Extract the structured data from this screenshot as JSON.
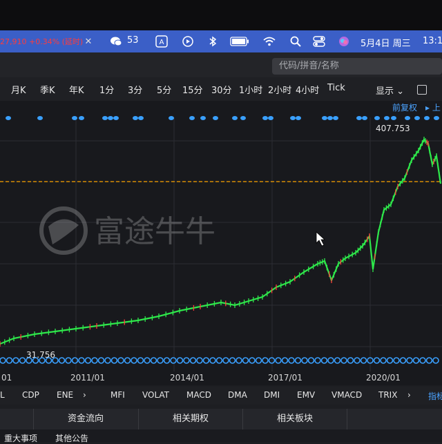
{
  "menubar": {
    "ticker_text": "27,910 +0.34% (延时)",
    "wechat_count": "53",
    "date_time": "5月4日 周三",
    "clock": "13:1",
    "battery_icon": "battery-icon"
  },
  "search": {
    "placeholder": "代码/拼音/名称"
  },
  "periods": [
    "月K",
    "季K",
    "年K",
    "1分",
    "3分",
    "5分",
    "15分",
    "30分",
    "1小时",
    "2小时",
    "4小时",
    "Tick"
  ],
  "display": {
    "label": "显示",
    "chevron": "⌄"
  },
  "chart": {
    "adjust_label": "前复权",
    "high_label": "407.753",
    "low_label": "31.756",
    "watermark": "富途牛牛",
    "x_labels": [
      "2011/01",
      "2014/01",
      "2017/01",
      "2020/01"
    ],
    "x_label_edge": "01",
    "colors": {
      "up": "#2ee84b",
      "down": "#ff3b3b",
      "ref_line": "#ffa500",
      "marker": "#3aa0ff"
    }
  },
  "indicators": [
    "L",
    "CDP",
    "ENE",
    "MFI",
    "VOLAT",
    "MACD",
    "DMA",
    "DMI",
    "EMV",
    "VMACD",
    "TRIX",
    "指标"
  ],
  "panels": [
    "资金流向",
    "相关期权",
    "相关板块"
  ],
  "footer": [
    "重大事项",
    "其他公告"
  ]
}
